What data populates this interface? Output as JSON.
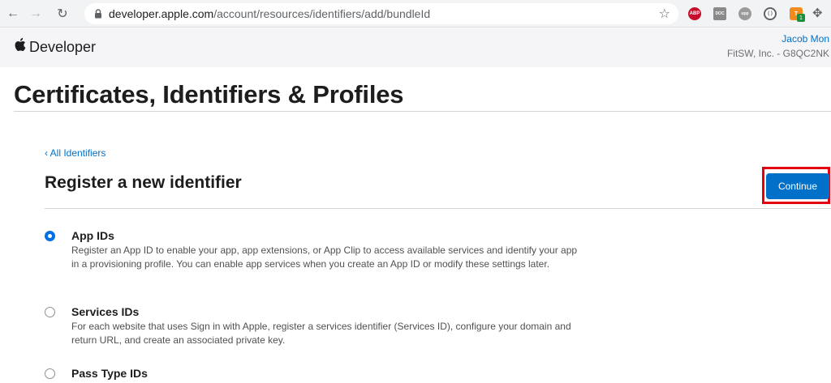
{
  "browser": {
    "url_host": "developer.apple.com",
    "url_path": "/account/resources/identifiers/add/bundleId",
    "extensions": {
      "abp": "ABP",
      "doc": "DOC",
      "upp": "upp",
      "orange": "T",
      "badge": "1"
    }
  },
  "header": {
    "brand": "Developer",
    "user_name": "Jacob Mon",
    "team": "FitSW, Inc. - G8QC2NK"
  },
  "page": {
    "title": "Certificates, Identifiers & Profiles",
    "back_link": "‹ All Identifiers",
    "section_title": "Register a new identifier",
    "continue_label": "Continue"
  },
  "options": [
    {
      "title": "App IDs",
      "description": "Register an App ID to enable your app, app extensions, or App Clip to access available services and identify your app in a provisioning profile. You can enable app services when you create an App ID or modify these settings later.",
      "selected": true
    },
    {
      "title": "Services IDs",
      "description": "For each website that uses Sign in with Apple, register a services identifier (Services ID), configure your domain and return URL, and create an associated private key.",
      "selected": false
    },
    {
      "title": "Pass Type IDs",
      "description": "",
      "selected": false
    }
  ],
  "colors": {
    "accent": "#0070c9",
    "highlight": "#e3000f"
  }
}
